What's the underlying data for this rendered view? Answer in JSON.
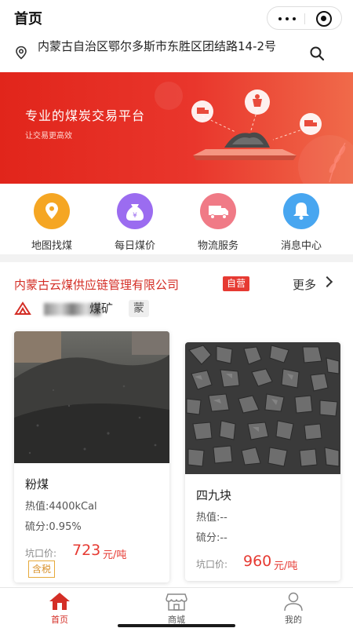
{
  "title_bar": {
    "title": "首页"
  },
  "address": {
    "text": "内蒙古自治区鄂尔多斯市东胜区团结路14-2号"
  },
  "banner": {
    "title": "专业的煤炭交易平台",
    "subtitle": "让交易更高效"
  },
  "menu": {
    "items": [
      {
        "label": "地图找煤",
        "icon": "map-pin-icon",
        "color": "#f5a623"
      },
      {
        "label": "每日煤价",
        "icon": "money-bag-icon",
        "color": "#9b6cf0"
      },
      {
        "label": "物流服务",
        "icon": "truck-icon",
        "color": "#f07a86"
      },
      {
        "label": "消息中心",
        "icon": "bell-icon",
        "color": "#48a6f0"
      }
    ]
  },
  "company": {
    "name": "内蒙古云煤供应链管理有限公司",
    "tag": "自营",
    "more": "更多",
    "mine_name": "煤矿",
    "province": "蒙"
  },
  "products": [
    {
      "name": "粉煤",
      "heat_label": "热值:",
      "heat": "4400kCal",
      "sulfur_label": "硫分:",
      "sulfur": "0.95%",
      "price_label": "坑口价:",
      "price": "723",
      "unit": "元/吨",
      "tax": "含税"
    },
    {
      "name": "四九块",
      "heat_label": "热值:",
      "heat": "--",
      "sulfur_label": "硫分:",
      "sulfur": "--",
      "price_label": "坑口价:",
      "price": "960",
      "unit": "元/吨"
    }
  ],
  "tabbar": {
    "items": [
      {
        "label": "首页",
        "icon": "home-icon",
        "active": true
      },
      {
        "label": "商城",
        "icon": "shop-icon",
        "active": false
      },
      {
        "label": "我的",
        "icon": "user-icon",
        "active": false
      }
    ]
  },
  "colors": {
    "brand_red": "#e1251b",
    "price_red": "#e63a32",
    "tax_orange": "#d8902a"
  }
}
